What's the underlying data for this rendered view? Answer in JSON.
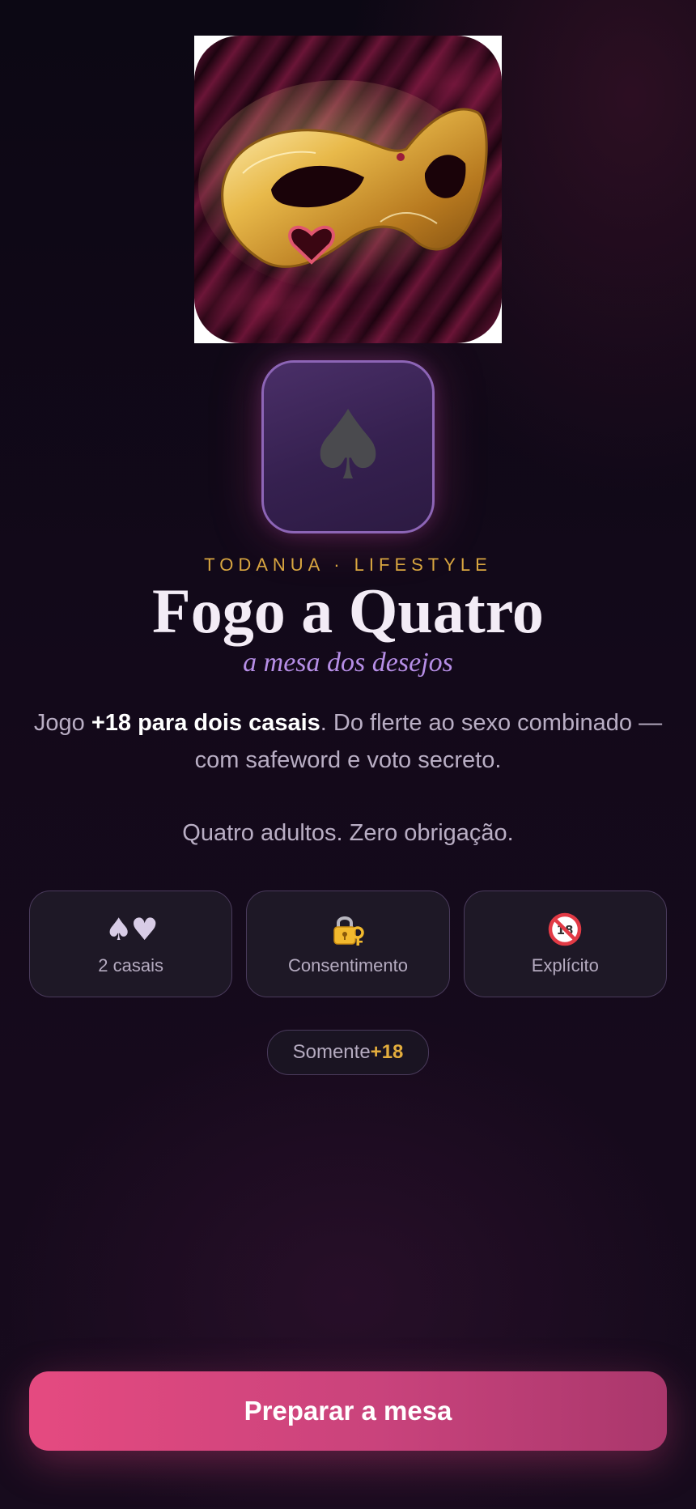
{
  "hero": {
    "image": "golden-masquerade-mask-on-burgundy-velvet"
  },
  "app_icon": {
    "glyph": "♠",
    "icon": "spade-icon"
  },
  "header": {
    "eyebrow": "TODANUA · LIFESTYLE",
    "title": "Fogo a Quatro",
    "subtitle": "a mesa dos desejos"
  },
  "description": {
    "prefix": "Jogo ",
    "highlight": "+18 para dois casais",
    "suffix": ". Do flerte ao sexo combinado — com safeword e voto secreto."
  },
  "tagline": "Quatro adultos. Zero obrigação.",
  "features": [
    {
      "icon": "spade-heart-icon",
      "glyph": "♠♥",
      "label": "2 casais"
    },
    {
      "icon": "lock-key-icon",
      "label": "Consentimento"
    },
    {
      "icon": "no-under-18-icon",
      "label": "Explícito"
    }
  ],
  "badge": {
    "text": "Somente",
    "accent": "+18"
  },
  "cta": {
    "label": "Preparar a mesa"
  },
  "colors": {
    "accent_gold": "#d9a640",
    "accent_purple": "#b68ee6",
    "cta_pink": "#e54a80",
    "background": "#13091a"
  }
}
